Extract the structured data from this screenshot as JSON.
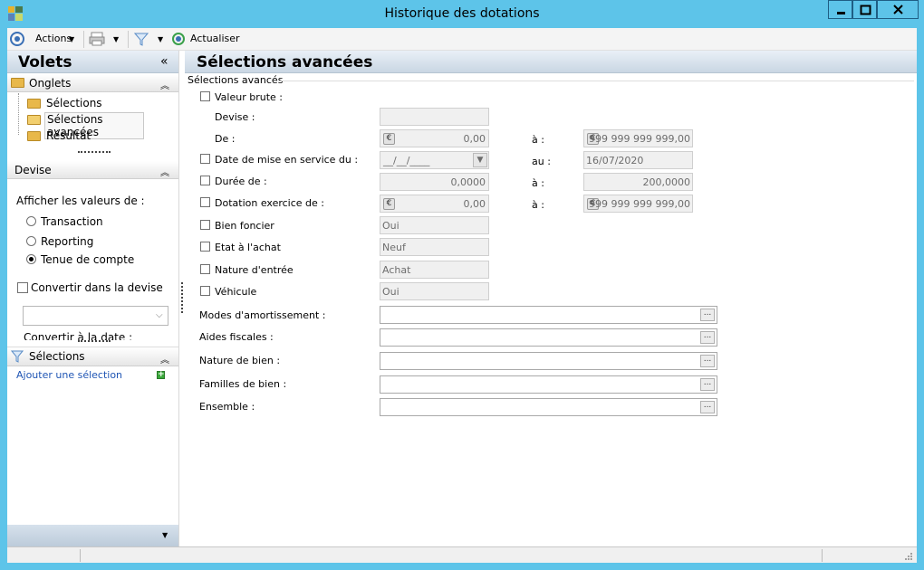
{
  "window": {
    "title": "Historique des dotations"
  },
  "toolbar": {
    "actions_label": "Actions",
    "refresh_label": "Actualiser"
  },
  "left": {
    "title": "Volets",
    "onglets": {
      "title": "Onglets",
      "items": [
        "Sélections",
        "Sélections avancées",
        "Résultat"
      ]
    },
    "devise": {
      "title": "Devise",
      "show_values_label": "Afficher les valeurs de :",
      "options": [
        "Transaction",
        "Reporting",
        "Tenue de compte"
      ],
      "selected": "Tenue de compte",
      "convert_label": "Convertir dans la devise",
      "convert_date_label": "Convertir à la date :"
    },
    "selections": {
      "title": "Sélections",
      "add_label": "Ajouter une sélection"
    }
  },
  "main": {
    "title": "Sélections avancées",
    "group_label": "Sélections avancés",
    "valeur_brute": {
      "label": "Valeur brute :",
      "devise_label": "Devise :",
      "de_label": "De :",
      "from": "0,00",
      "a_label": "à :",
      "to": "999 999 999 999,00"
    },
    "date_service": {
      "label": "Date de mise en service du :",
      "from": "__/__/____",
      "au_label": "au :",
      "to": "16/07/2020"
    },
    "duree": {
      "label": "Durée de :",
      "from": "0,0000",
      "a_label": "à :",
      "to": "200,0000"
    },
    "dotation": {
      "label": "Dotation exercice de :",
      "from": "0,00",
      "a_label": "à :",
      "to": "999 999 999 999,00"
    },
    "bien_foncier": {
      "label": "Bien foncier",
      "value": "Oui"
    },
    "etat_achat": {
      "label": "Etat à l'achat",
      "value": "Neuf"
    },
    "nature_entree": {
      "label": "Nature d'entrée",
      "value": "Achat"
    },
    "vehicule": {
      "label": "Véhicule",
      "value": "Oui"
    },
    "lookups": [
      "Modes d'amortissement :",
      "Aides fiscales :",
      "Nature de bien :",
      "Familles de bien :",
      "Ensemble :"
    ],
    "euro_symbol": "€",
    "ellipsis": "..."
  }
}
